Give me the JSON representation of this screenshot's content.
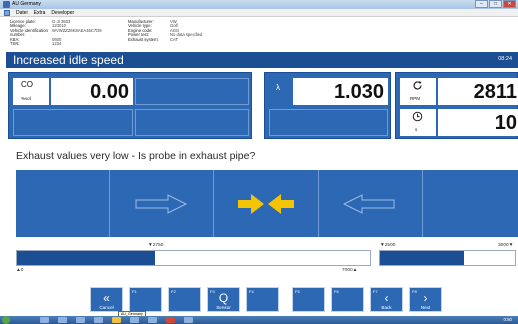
{
  "window": {
    "title": "AU Germany",
    "min": "–",
    "max": "□",
    "close": "✕"
  },
  "menu": [
    "Datei",
    "Extra",
    "Developer"
  ],
  "vehicle_info": {
    "left": [
      {
        "k": "Licence plate:",
        "v": "G-JI 3503"
      },
      {
        "k": "Mileage:",
        "v": "123010"
      },
      {
        "k": "Vehicle identification number:",
        "v": "WVWZZZ6K8AEA46C7D8"
      },
      {
        "k": "KBA:",
        "v": "0600"
      },
      {
        "k": "TSN:",
        "v": "1234"
      }
    ],
    "right": [
      {
        "k": "Manufacturer:",
        "v": "VW"
      },
      {
        "k": "Vehicle type:",
        "v": "Golf"
      },
      {
        "k": "Engine code:",
        "v": "AGG"
      },
      {
        "k": "Power test:",
        "v": "No data specified"
      },
      {
        "k": "Exhaust system:",
        "v": "CAT"
      }
    ]
  },
  "header": {
    "title": "Increased idle speed",
    "time": "08:24"
  },
  "readings": {
    "co": {
      "label": "CO",
      "unit": "%vol",
      "value": "0.00"
    },
    "lambda": {
      "label": "λ",
      "value": "1.030"
    },
    "rpm": {
      "unit": "RPM",
      "value": "2811"
    },
    "time": {
      "unit": "s",
      "value": "10"
    }
  },
  "message": "Exhaust values very low - Is probe in exhaust pipe?",
  "gauges": {
    "left": {
      "marker_value": "▼2750",
      "min": "▲0",
      "max": "7000▲",
      "level": 0.39
    },
    "right": {
      "low": "▼2500",
      "high": "3000▼",
      "level": 0.62
    }
  },
  "buttons": [
    {
      "key": "",
      "label": "Cancel",
      "glyph": "«"
    },
    {
      "key": "F1",
      "label": "",
      "glyph": ""
    },
    {
      "key": "F2",
      "label": "",
      "glyph": ""
    },
    {
      "key": "F3",
      "label": "Sensor",
      "glyph": "Q"
    },
    {
      "key": "F4",
      "label": "",
      "glyph": ""
    },
    {
      "key": "F5",
      "label": "",
      "glyph": ""
    },
    {
      "key": "F6",
      "label": "",
      "glyph": ""
    },
    {
      "key": "F7",
      "label": "Back",
      "glyph": "‹"
    },
    {
      "key": "F8",
      "label": "Next",
      "glyph": "›"
    }
  ],
  "tooltip": "AU_Germany",
  "clock": "0:50",
  "colors": {
    "primary": "#2d68b4",
    "header": "#1b4e92",
    "arrow_active": "#f5c400"
  }
}
